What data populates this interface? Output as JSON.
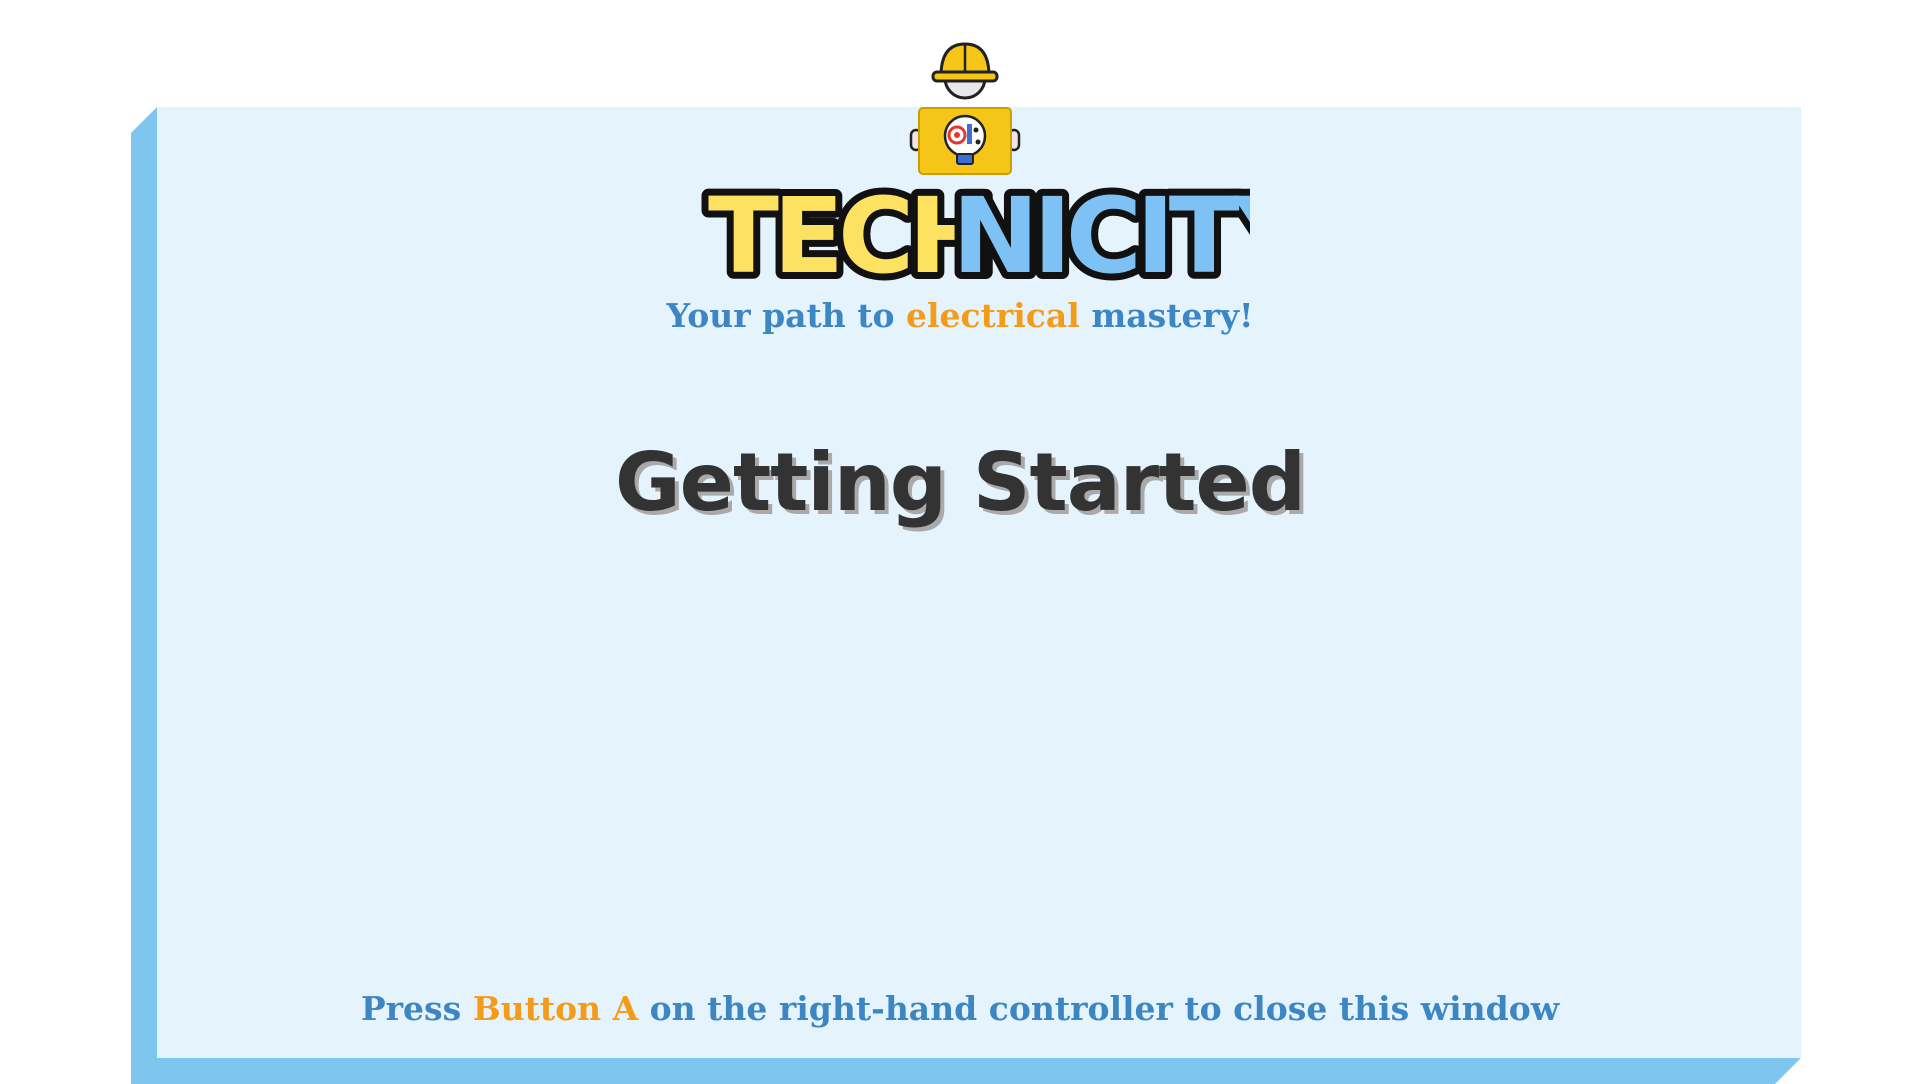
{
  "branding": {
    "logo_part1": "TECH",
    "logo_part2": "NICITY",
    "logo_colors": {
      "yellow": "#fde160",
      "blue": "#7ec2f5",
      "outline": "#111111"
    },
    "mascot_icon": "engineer-hardhat-lightbulb-icon"
  },
  "tagline": {
    "before": "Your path to",
    "highlight": "electrical",
    "after": "mastery!"
  },
  "title": "Getting Started",
  "instruction": {
    "before": "Press",
    "highlight": "Button A",
    "after": "on the right-hand controller to close this window"
  },
  "colors": {
    "panel_bg": "#e5f3fd",
    "panel_edge": "#7ec6ee",
    "text_blue": "#3d86c4",
    "accent_orange": "#f59b1a",
    "title_dark": "#333333"
  }
}
